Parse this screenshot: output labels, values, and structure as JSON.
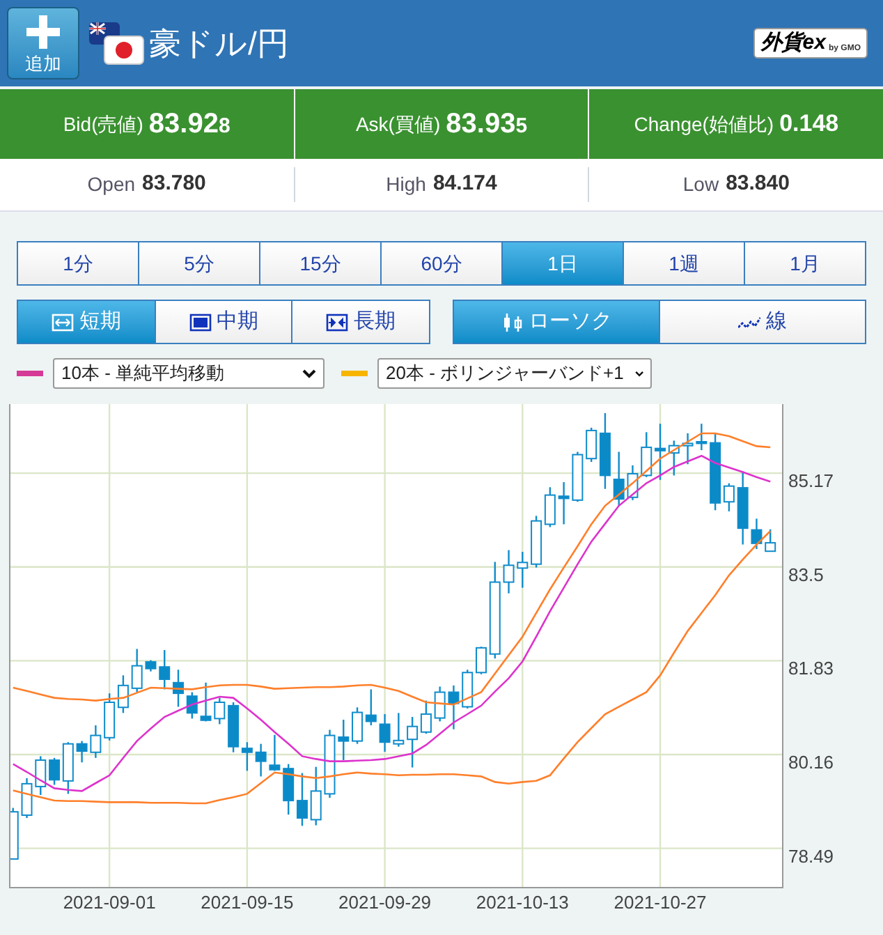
{
  "header": {
    "add_button": "追加",
    "title": "豪ドル/円",
    "logo": {
      "main": "外貨ex",
      "sub": "by GMO"
    }
  },
  "quotes": [
    {
      "label": "Bid(売値)",
      "value": "83.92",
      "pip": "8"
    },
    {
      "label": "Ask(買値)",
      "value": "83.93",
      "pip": "5"
    },
    {
      "label": "Change(始値比)",
      "value": "0.148"
    }
  ],
  "stats": [
    {
      "label": "Open",
      "value": "83.780"
    },
    {
      "label": "High",
      "value": "84.174"
    },
    {
      "label": "Low",
      "value": "83.840"
    }
  ],
  "periods": [
    {
      "label": "1分",
      "selected": false
    },
    {
      "label": "5分",
      "selected": false
    },
    {
      "label": "15分",
      "selected": false
    },
    {
      "label": "60分",
      "selected": false
    },
    {
      "label": "1日",
      "selected": true
    },
    {
      "label": "1週",
      "selected": false
    },
    {
      "label": "1月",
      "selected": false
    }
  ],
  "ranges": [
    {
      "label": "短期",
      "kind": "short",
      "selected": true
    },
    {
      "label": "中期",
      "kind": "medium",
      "selected": false
    },
    {
      "label": "長期",
      "kind": "long",
      "selected": false
    }
  ],
  "chart_types": [
    {
      "label": "ローソク",
      "kind": "candle",
      "selected": true
    },
    {
      "label": "線",
      "kind": "line",
      "selected": false
    }
  ],
  "indicators": [
    {
      "color": "#d63a97",
      "value": "10本 - 単純平均移動"
    },
    {
      "color": "#f7b500",
      "value": "20本 - ボリンジャーバンド+1"
    }
  ],
  "chart": {
    "chart_data": {
      "type": "candlestick",
      "categories": [
        null,
        null,
        null,
        null,
        null,
        null,
        null,
        "2021-09-01",
        null,
        null,
        null,
        null,
        null,
        null,
        null,
        null,
        null,
        "2021-09-15",
        null,
        null,
        null,
        null,
        null,
        null,
        null,
        null,
        null,
        "2021-09-29",
        null,
        null,
        null,
        null,
        null,
        null,
        null,
        null,
        null,
        "2021-10-13",
        null,
        null,
        null,
        null,
        null,
        null,
        null,
        null,
        null,
        "2021-10-27",
        null,
        null,
        null,
        null,
        null,
        null,
        null,
        null
      ],
      "ylim": [
        77.79,
        86.4
      ],
      "grid": true,
      "yticks": [
        85.17,
        83.5,
        81.83,
        80.16,
        78.49
      ],
      "series": [
        {
          "type": "line",
          "color": "#dd33cc",
          "values": [
            79.99,
            79.85,
            79.7,
            79.56,
            79.53,
            79.51,
            79.65,
            79.79,
            80.1,
            80.4,
            80.62,
            80.83,
            80.94,
            81.05,
            81.12,
            81.19,
            81.17,
            80.98,
            80.78,
            80.56,
            80.35,
            80.13,
            80.08,
            80.04,
            80.04,
            80.05,
            80.06,
            80.08,
            80.13,
            80.18,
            80.33,
            80.53,
            80.73,
            80.88,
            81.03,
            81.28,
            81.52,
            81.82,
            82.26,
            82.71,
            83.13,
            83.55,
            83.95,
            84.27,
            84.59,
            84.79,
            84.99,
            85.13,
            85.28,
            85.38,
            85.48,
            85.35,
            85.27,
            85.19,
            85.1,
            85.02
          ]
        },
        {
          "type": "line",
          "color": "#ff7f2a",
          "values": [
            81.35,
            81.29,
            81.23,
            81.17,
            81.15,
            81.14,
            81.12,
            81.15,
            81.17,
            81.26,
            81.35,
            81.34,
            81.33,
            81.32,
            81.36,
            81.39,
            81.4,
            81.4,
            81.37,
            81.33,
            81.34,
            81.35,
            81.36,
            81.36,
            81.37,
            81.39,
            81.4,
            81.35,
            81.29,
            81.19,
            81.09,
            81.07,
            81.05,
            81.16,
            81.27,
            81.6,
            81.93,
            82.26,
            82.68,
            83.1,
            83.49,
            83.87,
            84.26,
            84.59,
            84.79,
            84.99,
            85.21,
            85.43,
            85.58,
            85.73,
            85.88,
            85.88,
            85.83,
            85.74,
            85.65,
            85.63
          ]
        },
        {
          "type": "line",
          "color": "#ff7f2a",
          "values": [
            79.52,
            79.46,
            79.4,
            79.34,
            79.33,
            79.33,
            79.32,
            79.31,
            79.31,
            79.31,
            79.3,
            79.3,
            79.3,
            79.29,
            79.29,
            79.35,
            79.4,
            79.46,
            79.65,
            79.84,
            79.81,
            79.77,
            79.74,
            79.77,
            79.81,
            79.84,
            79.82,
            79.81,
            79.79,
            79.8,
            79.8,
            79.81,
            79.81,
            79.79,
            79.77,
            79.67,
            79.64,
            79.67,
            79.69,
            79.79,
            80.09,
            80.38,
            80.63,
            80.88,
            81.01,
            81.14,
            81.27,
            81.57,
            81.97,
            82.36,
            82.68,
            83.0,
            83.35,
            83.63,
            83.9,
            84.14
          ]
        }
      ],
      "ohlc": [
        [
          78.3,
          79.21,
          78.3,
          79.14
        ],
        [
          79.08,
          79.74,
          79.03,
          79.64
        ],
        [
          79.59,
          80.13,
          79.44,
          80.06
        ],
        [
          80.06,
          80.1,
          79.62,
          79.71
        ],
        [
          79.69,
          80.38,
          79.46,
          80.35
        ],
        [
          80.35,
          80.4,
          80.02,
          80.22
        ],
        [
          80.2,
          80.68,
          80.1,
          80.5
        ],
        [
          80.46,
          81.25,
          80.41,
          81.09
        ],
        [
          81.0,
          81.57,
          80.9,
          81.39
        ],
        [
          81.34,
          82.04,
          81.27,
          81.74
        ],
        [
          81.81,
          81.84,
          81.64,
          81.69
        ],
        [
          81.72,
          82.02,
          81.32,
          81.5
        ],
        [
          81.44,
          81.67,
          81.01,
          81.25
        ],
        [
          81.2,
          81.27,
          80.8,
          80.9
        ],
        [
          80.84,
          81.44,
          80.75,
          80.77
        ],
        [
          80.8,
          81.17,
          80.7,
          81.09
        ],
        [
          81.03,
          81.09,
          80.2,
          80.3
        ],
        [
          80.27,
          80.38,
          79.87,
          80.2
        ],
        [
          80.2,
          80.35,
          79.77,
          80.04
        ],
        [
          79.97,
          80.51,
          79.87,
          79.89
        ],
        [
          79.91,
          79.99,
          79.09,
          79.34
        ],
        [
          79.34,
          79.83,
          78.89,
          79.03
        ],
        [
          79.0,
          79.94,
          78.9,
          79.51
        ],
        [
          79.46,
          80.6,
          79.39,
          80.5
        ],
        [
          80.47,
          80.78,
          80.06,
          80.4
        ],
        [
          80.4,
          81.0,
          80.35,
          80.91
        ],
        [
          80.86,
          81.32,
          80.68,
          80.75
        ],
        [
          80.7,
          80.88,
          80.21,
          80.38
        ],
        [
          80.35,
          80.9,
          80.3,
          80.41
        ],
        [
          80.43,
          80.83,
          79.93,
          80.66
        ],
        [
          80.56,
          81.12,
          80.53,
          80.88
        ],
        [
          80.81,
          81.37,
          80.75,
          81.27
        ],
        [
          81.27,
          81.39,
          80.61,
          81.07
        ],
        [
          81.01,
          81.67,
          80.98,
          81.62
        ],
        [
          81.62,
          82.08,
          81.59,
          82.06
        ],
        [
          81.95,
          83.59,
          81.87,
          83.23
        ],
        [
          83.23,
          83.8,
          83.03,
          83.53
        ],
        [
          83.48,
          83.77,
          83.13,
          83.58
        ],
        [
          83.55,
          84.41,
          83.49,
          84.32
        ],
        [
          84.26,
          84.92,
          84.21,
          84.78
        ],
        [
          84.76,
          85.01,
          84.26,
          84.72
        ],
        [
          84.69,
          85.55,
          84.66,
          85.5
        ],
        [
          85.43,
          85.98,
          85.37,
          85.93
        ],
        [
          85.88,
          86.24,
          84.89,
          85.13
        ],
        [
          85.06,
          85.55,
          84.59,
          84.71
        ],
        [
          84.74,
          85.31,
          84.69,
          85.16
        ],
        [
          85.13,
          85.9,
          85.1,
          85.63
        ],
        [
          85.61,
          86.05,
          85.05,
          85.57
        ],
        [
          85.53,
          85.75,
          85.13,
          85.66
        ],
        [
          85.66,
          85.88,
          85.33,
          85.7
        ],
        [
          85.73,
          86.05,
          85.58,
          85.7
        ],
        [
          85.71,
          85.88,
          84.51,
          84.64
        ],
        [
          84.66,
          84.99,
          84.49,
          84.94
        ],
        [
          84.91,
          85.2,
          83.9,
          84.19
        ],
        [
          84.16,
          84.36,
          83.82,
          83.92
        ],
        [
          83.78,
          84.17,
          83.78,
          83.93
        ]
      ]
    }
  }
}
